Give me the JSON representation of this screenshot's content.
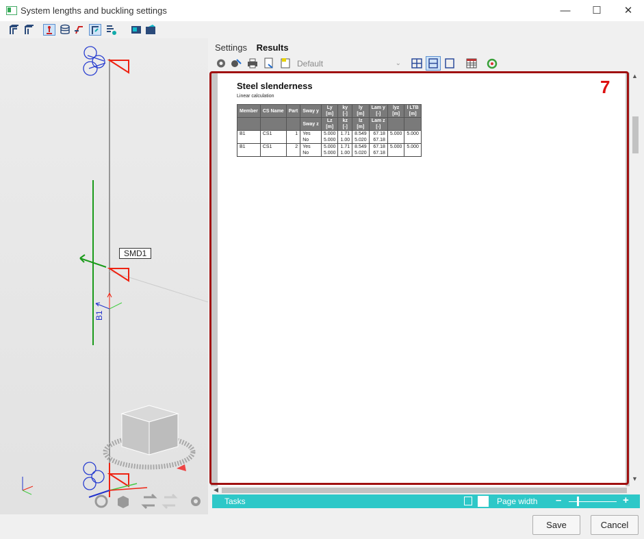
{
  "window": {
    "title": "System lengths and buckling settings",
    "minimize": "—",
    "maximize": "☐",
    "close": "✕"
  },
  "viewport": {
    "node_label": "SMD1",
    "member_label": "B1"
  },
  "tabs": [
    {
      "label": "Settings"
    },
    {
      "label": "Results"
    }
  ],
  "toolbar": {
    "preset": "Default"
  },
  "annotation_number": "7",
  "report": {
    "title": "Steel slenderness",
    "subtitle": "Linear calculation",
    "header1": [
      "Member",
      "CS Name",
      "Part",
      "Sway y",
      "Ly\n[m]",
      "ky\n[-]",
      "ly\n[m]",
      "Lam y\n[-]",
      "lyz\n[m]",
      "l LTB\n[m]"
    ],
    "header2": [
      "",
      "",
      "",
      "Sway z",
      "Lz\n[m]",
      "kz\n[-]",
      "lz\n[m]",
      "Lam z\n[-]",
      "",
      ""
    ],
    "rows": [
      {
        "a": [
          "B1",
          "CS1",
          "1",
          "Yes",
          "5.000",
          "1.71",
          "8.549",
          "67.18",
          "5.000",
          "5.000"
        ],
        "b": [
          "",
          "",
          "",
          "No",
          "5.000",
          "1.00",
          "5.020",
          "67.18",
          "",
          ""
        ]
      },
      {
        "a": [
          "B1",
          "CS1",
          "2",
          "Yes",
          "5.000",
          "1.71",
          "8.549",
          "67.18",
          "5.000",
          "5.000"
        ],
        "b": [
          "",
          "",
          "",
          "No",
          "5.000",
          "1.00",
          "5.020",
          "67.18",
          "",
          ""
        ]
      }
    ]
  },
  "taskbar": {
    "tasks": "Tasks",
    "zoom_mode": "Page width",
    "minus": "–",
    "plus": "+"
  },
  "buttons": {
    "save": "Save",
    "cancel": "Cancel"
  },
  "colors": {
    "accent": "#2ec8c8",
    "frame": "#a01010",
    "badge": "#dd1111"
  }
}
